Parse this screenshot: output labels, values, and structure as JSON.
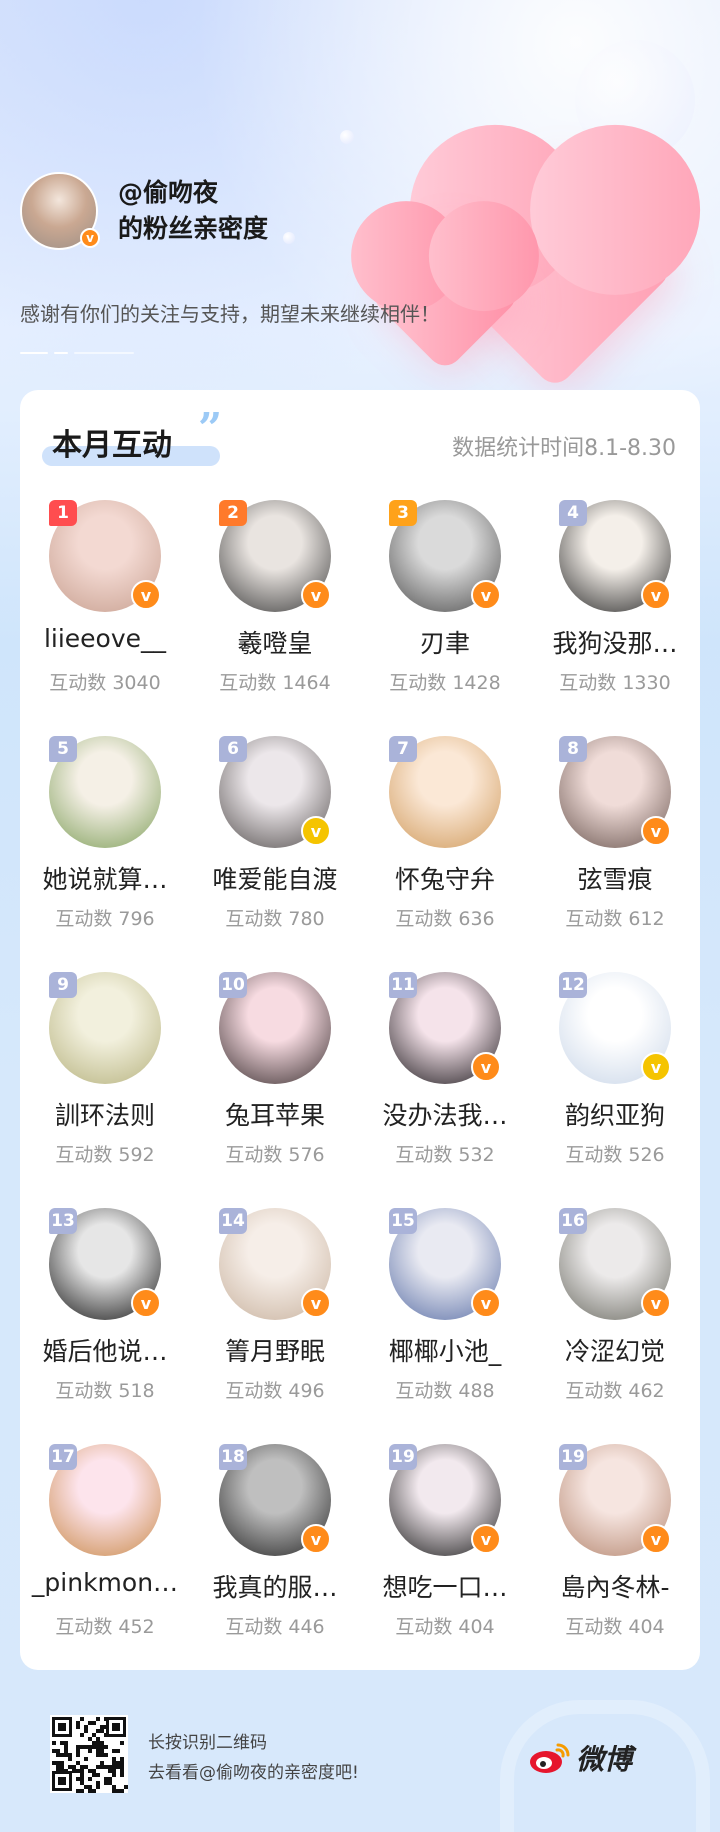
{
  "header": {
    "handle": "@偷吻夜",
    "subtitle": "的粉丝亲密度",
    "thanks": "感谢有你们的关注与支持，期望未来继续相伴！"
  },
  "card": {
    "title": "本月互动",
    "stat_range": "数据统计时间8.1-8.30"
  },
  "fans": [
    {
      "rank": "1",
      "name": "liieeove__",
      "count": "互动数 3040",
      "badge": "orange",
      "tone": "rank-top",
      "avatar": [
        "#f3d9d2",
        "#c79f8f"
      ]
    },
    {
      "rank": "2",
      "name": "羲噔皇",
      "count": "互动数 1464",
      "badge": "orange",
      "tone": "rank-top",
      "avatar": [
        "#e9e4e0",
        "#3c3c3c"
      ]
    },
    {
      "rank": "3",
      "name": "刃聿",
      "count": "互动数 1428",
      "badge": "orange",
      "tone": "rank-top",
      "avatar": [
        "#dadada",
        "#4d4d4d"
      ]
    },
    {
      "rank": "4",
      "name": "我狗没那…",
      "count": "互动数 1330",
      "badge": "orange",
      "tone": "rank",
      "avatar": [
        "#f4efe9",
        "#2a2a2a"
      ]
    },
    {
      "rank": "5",
      "name": "她说就算…",
      "count": "互动数 796",
      "badge": "none",
      "tone": "rank",
      "avatar": [
        "#f5f0e6",
        "#7f9f5a"
      ]
    },
    {
      "rank": "6",
      "name": "唯爱能自渡",
      "count": "互动数 780",
      "badge": "gold",
      "tone": "rank",
      "avatar": [
        "#ece7ea",
        "#55504f"
      ]
    },
    {
      "rank": "7",
      "name": "怀兔守弁",
      "count": "互动数 636",
      "badge": "none",
      "tone": "rank",
      "avatar": [
        "#fbe8d6",
        "#d09b5d"
      ]
    },
    {
      "rank": "8",
      "name": "弦雪痕",
      "count": "互动数 612",
      "badge": "orange",
      "tone": "rank",
      "avatar": [
        "#f0dcd8",
        "#6a5650"
      ]
    },
    {
      "rank": "9",
      "name": "訓环法则",
      "count": "互动数 592",
      "badge": "none",
      "tone": "rank",
      "avatar": [
        "#f2f0dd",
        "#b6b27e"
      ]
    },
    {
      "rank": "10",
      "name": "兔耳苹果",
      "count": "互动数 576",
      "badge": "none",
      "tone": "rank",
      "avatar": [
        "#f7dbe1",
        "#3a2f30"
      ]
    },
    {
      "rank": "11",
      "name": "没办法我…",
      "count": "互动数 532",
      "badge": "orange",
      "tone": "rank",
      "avatar": [
        "#f5e3ea",
        "#1e1a1e"
      ]
    },
    {
      "rank": "12",
      "name": "韵织亚狗",
      "count": "互动数 526",
      "badge": "gold",
      "tone": "rank",
      "avatar": [
        "#ffffff",
        "#c9d6e8"
      ]
    },
    {
      "rank": "13",
      "name": "婚后他说…",
      "count": "互动数 518",
      "badge": "orange",
      "tone": "rank",
      "avatar": [
        "#e6e6e6",
        "#151515"
      ]
    },
    {
      "rank": "14",
      "name": "箐月野眠",
      "count": "互动数 496",
      "badge": "orange",
      "tone": "rank",
      "avatar": [
        "#f6eee8",
        "#c8b29e"
      ]
    },
    {
      "rank": "15",
      "name": "椰椰小池_",
      "count": "互动数 488",
      "badge": "orange",
      "tone": "rank",
      "avatar": [
        "#e9eaf2",
        "#5a6fa6"
      ]
    },
    {
      "rank": "16",
      "name": "冷涩幻觉",
      "count": "互动数 462",
      "badge": "orange",
      "tone": "rank",
      "avatar": [
        "#eceaea",
        "#6b6b62"
      ]
    },
    {
      "rank": "17",
      "name": "_pinkmon…",
      "count": "互动数 452",
      "badge": "none",
      "tone": "rank",
      "avatar": [
        "#fde4ec",
        "#c98a4a"
      ]
    },
    {
      "rank": "18",
      "name": "我真的服…",
      "count": "互动数 446",
      "badge": "orange",
      "tone": "rank",
      "avatar": [
        "#bfbfbf",
        "#242424"
      ]
    },
    {
      "rank": "19",
      "name": "想吃一口…",
      "count": "互动数 404",
      "badge": "orange",
      "tone": "rank",
      "avatar": [
        "#f2e9ee",
        "#1b1b1b"
      ]
    },
    {
      "rank": "19",
      "name": "島內冬林-",
      "count": "互动数 404",
      "badge": "orange",
      "tone": "rank",
      "avatar": [
        "#f6e5e0",
        "#b58770"
      ]
    }
  ],
  "footer": {
    "line1": "长按识别二维码",
    "line2": "去看看@偷吻夜的亲密度吧!",
    "brand": "微博"
  },
  "colors": {
    "verified_orange": "#ff8b1a",
    "verified_gold": "#f5c400",
    "rank1": "#ff4d4f",
    "rank2": "#ff7a2b",
    "rank3": "#ffa21a",
    "rank_default": "#aab3d9"
  }
}
